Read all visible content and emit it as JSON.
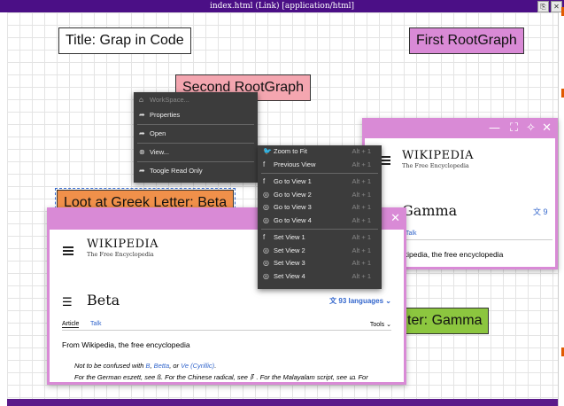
{
  "window": {
    "title": "index.html (Link) [application/html]"
  },
  "nodes": {
    "title": "Title: Grap in Code",
    "first_root": "First RootGraph",
    "second_root": "Second RootGraph",
    "beta_node": "Loot at Greek Letter: Beta",
    "gamma_node": "ter: Gamma"
  },
  "colors": {
    "first_root": "#d98ad6",
    "second_root": "#f4a6b0",
    "beta_node": "#f0904a",
    "gamma_node": "#8cc63f",
    "popup_frame": "#d98ad6"
  },
  "context_menu": {
    "header": "WorkSpace...",
    "items": [
      "Properties",
      "Open",
      "View...",
      "Toogle Read Only"
    ]
  },
  "view_menu": {
    "zoom": [
      {
        "label": "Zoom to Fit",
        "shortcut": "Alt + 1"
      },
      {
        "label": "Previous View",
        "shortcut": "Alt + 1"
      }
    ],
    "goto": [
      {
        "label": "Go to View 1",
        "shortcut": "Alt + 1"
      },
      {
        "label": "Go to View 2",
        "shortcut": "Alt + 1"
      },
      {
        "label": "Go to View 3",
        "shortcut": "Alt + 1"
      },
      {
        "label": "Go to View 4",
        "shortcut": "Alt + 1"
      }
    ],
    "set": [
      {
        "label": "Set View 1",
        "shortcut": "Alt + 1"
      },
      {
        "label": "Set View 2",
        "shortcut": "Alt + 1"
      },
      {
        "label": "Set View 3",
        "shortcut": "Alt + 1"
      },
      {
        "label": "Set View 4",
        "shortcut": "Alt + 1"
      }
    ]
  },
  "gamma_popup": {
    "logo": "WIKIPEDIA",
    "tagline": "The Free Encyclopedia",
    "article": "Gamma",
    "lang_count": "9",
    "tab": "Talk",
    "intro": "ikipedia, the free encyclopedia"
  },
  "beta_popup": {
    "logo": "WIKIPEDIA",
    "tagline": "The Free Encyclopedia",
    "article": "Beta",
    "languages": "93 languages",
    "tab_article": "Article",
    "tab_talk": "Talk",
    "tools": "Tools",
    "intro": "From Wikipedia, the free encyclopedia",
    "hat1_prefix": "Not to be confused with",
    "hat1_link1": "B",
    "hat1_link2": "Betta",
    "hat1_or": ", or",
    "hat1_link3": "Ve (Cyrillic)",
    "hat2_text": "For the German eszett, see ß. For the Chinese radical, see 阝. For the Malayalam script, see ഥ. For"
  }
}
